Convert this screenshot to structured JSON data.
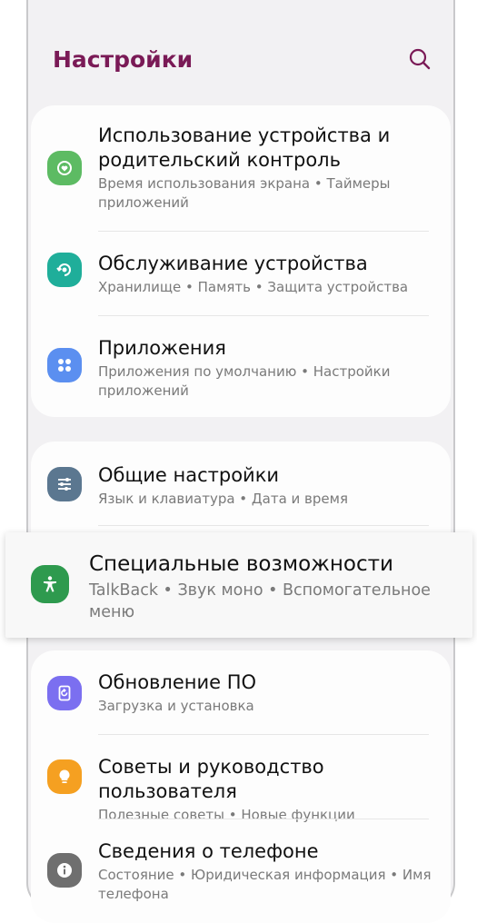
{
  "header": {
    "title": "Настройки",
    "search_icon": "search-icon"
  },
  "colors": {
    "title": "#7a1a56",
    "digital_wellbeing": "#5dbb63",
    "device_care": "#1fae9a",
    "apps": "#5b8ff0",
    "general": "#5b7790",
    "accessibility": "#2e9a4e",
    "software_update": "#7b6ff0",
    "tips": "#f5a021",
    "about": "#6f6f6f"
  },
  "groups": [
    {
      "items": [
        {
          "title": "Использование устройства и родительский контроль",
          "subtitle": "Время использования экрана • Таймеры приложений",
          "icon": "digital-wellbeing-icon"
        },
        {
          "title": "Обслуживание устройства",
          "subtitle": "Хранилище • Память • Защита устройства",
          "icon": "device-care-icon"
        },
        {
          "title": "Приложения",
          "subtitle": "Приложения по умолчанию • Настройки приложений",
          "icon": "apps-icon"
        }
      ]
    },
    {
      "items": [
        {
          "title": "Общие настройки",
          "subtitle": "Язык и клавиатура • Дата и время",
          "icon": "sliders-icon"
        },
        {
          "title": "Специальные возможности",
          "subtitle": "TalkBack • Звук моно • Вспомогательное меню",
          "icon": "accessibility-icon"
        }
      ]
    },
    {
      "items": [
        {
          "title": "Обновление ПО",
          "subtitle": "Загрузка и установка",
          "icon": "software-update-icon"
        },
        {
          "title": "Советы и руководство пользователя",
          "subtitle": "Полезные советы • Новые функции",
          "icon": "lightbulb-icon"
        },
        {
          "title": "Сведения о телефоне",
          "subtitle": "Состояние • Юридическая информация • Имя телефона",
          "icon": "info-icon"
        }
      ]
    }
  ]
}
